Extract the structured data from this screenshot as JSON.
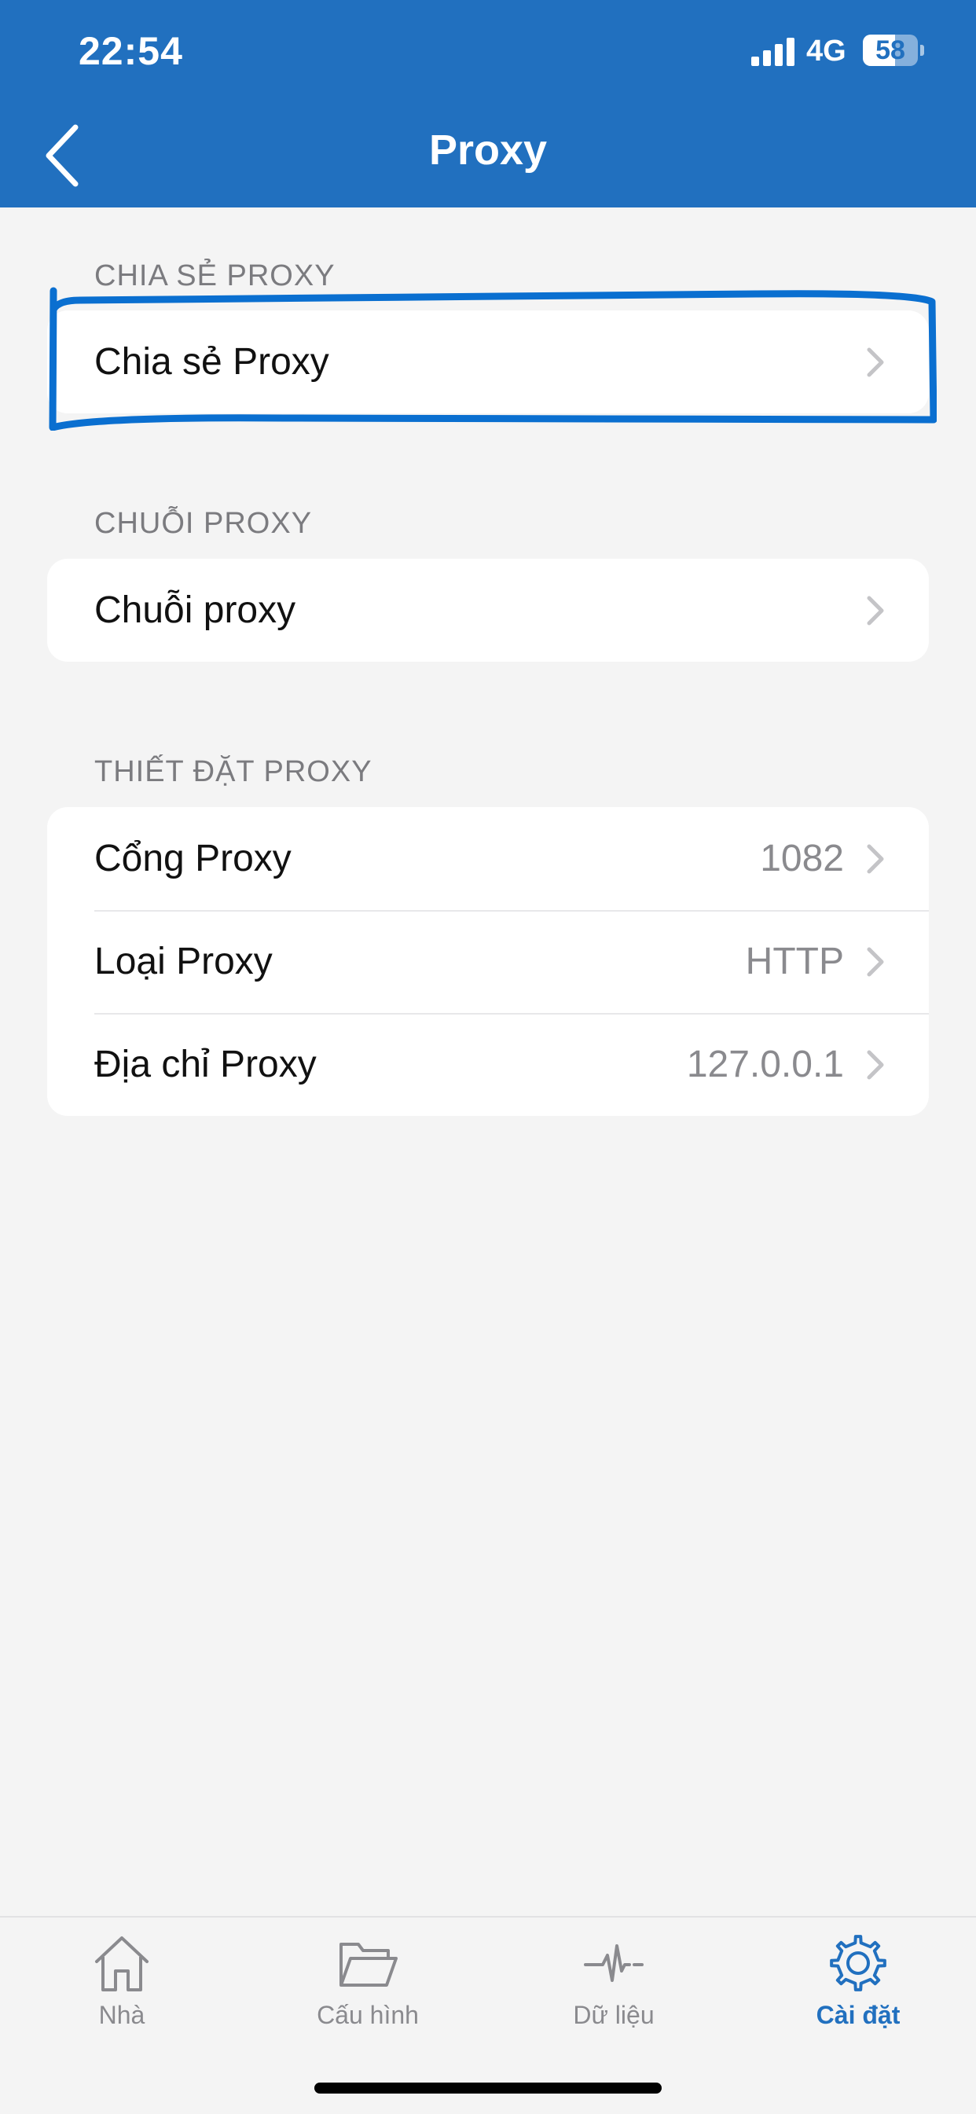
{
  "status_bar": {
    "time": "22:54",
    "network": "4G",
    "battery": "58",
    "battery_level_percent": 58
  },
  "nav": {
    "title": "Proxy",
    "back_icon": "chevron-left-icon"
  },
  "sections": {
    "share": {
      "header": "CHIA SẺ PROXY",
      "rows": [
        {
          "label": "Chia sẻ Proxy",
          "value": ""
        }
      ]
    },
    "chain": {
      "header": "CHUỖI PROXY",
      "rows": [
        {
          "label": "Chuỗi proxy",
          "value": ""
        }
      ]
    },
    "settings": {
      "header": "THIẾT ĐẶT PROXY",
      "rows": [
        {
          "label": "Cổng Proxy",
          "value": "1082"
        },
        {
          "label": "Loại Proxy",
          "value": "HTTP"
        },
        {
          "label": "Địa chỉ Proxy",
          "value": "127.0.0.1"
        }
      ]
    }
  },
  "highlight_color": "#0a6fd0",
  "tabbar": {
    "tabs": [
      {
        "label": "Nhà",
        "icon": "home-icon",
        "active": false
      },
      {
        "label": "Cấu hình",
        "icon": "folder-icon",
        "active": false
      },
      {
        "label": "Dữ liệu",
        "icon": "pulse-icon",
        "active": false
      },
      {
        "label": "Cài đặt",
        "icon": "gear-icon",
        "active": true
      }
    ],
    "active_color": "#2170bf",
    "inactive_color": "#8a8a8e"
  }
}
